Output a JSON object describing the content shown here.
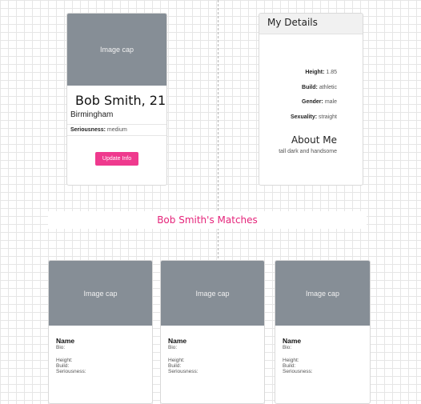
{
  "profile": {
    "image_cap": "Image cap",
    "name_age": "Bob Smith, 21",
    "city": "Birmingham",
    "seriousness_label": "Seriousness:",
    "seriousness_value": "medium",
    "update_button": "Update Info"
  },
  "details": {
    "title": "My Details",
    "rows": [
      {
        "label": "Height:",
        "value": "1.85"
      },
      {
        "label": "Build:",
        "value": "athletic"
      },
      {
        "label": "Gender:",
        "value": "male"
      },
      {
        "label": "Sexuality:",
        "value": "straight"
      }
    ],
    "about_title": "About Me",
    "about_text": "tall dark and handsome"
  },
  "matches": {
    "title": "Bob Smith's Matches",
    "cards": [
      {
        "image_cap": "Image cap",
        "name": "Name",
        "bio": "Bio:",
        "height": "Height:",
        "build": "Build:",
        "seriousness": "Seriousness:"
      },
      {
        "image_cap": "Image cap",
        "name": "Name",
        "bio": "Bio:",
        "height": "Height:",
        "build": "Build:",
        "seriousness": "Seriousness:"
      },
      {
        "image_cap": "Image cap",
        "name": "Name",
        "bio": "Bio:",
        "height": "Height:",
        "build": "Build:",
        "seriousness": "Seriousness:"
      }
    ]
  },
  "colors": {
    "accent": "#ef3a8e",
    "matches_title": "#e5247a",
    "image_placeholder": "#868e96"
  }
}
